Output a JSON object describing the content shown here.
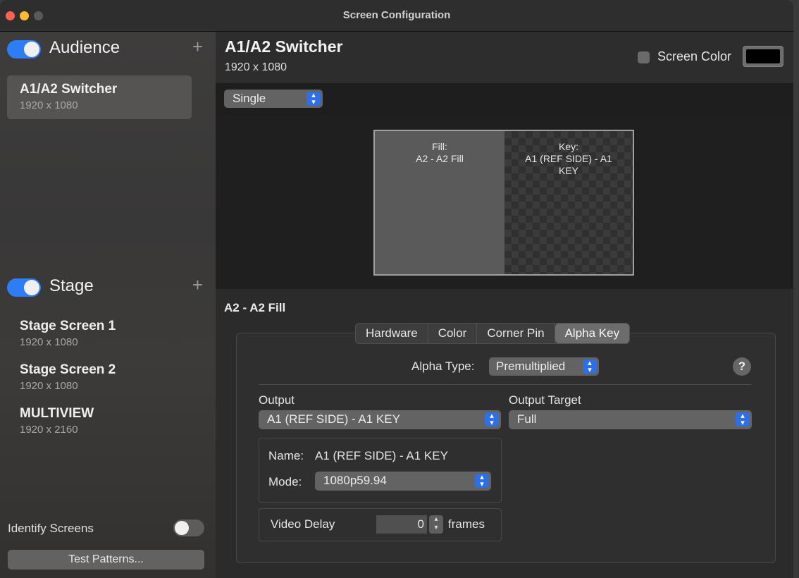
{
  "window": {
    "title": "Screen Configuration"
  },
  "sidebar": {
    "audience": {
      "title": "Audience",
      "enabled": true,
      "add_symbol": "+",
      "screens": [
        {
          "name": "A1/A2 Switcher",
          "resolution": "1920 x 1080",
          "selected": true
        }
      ]
    },
    "stage": {
      "title": "Stage",
      "enabled": true,
      "add_symbol": "+",
      "screens": [
        {
          "name": "Stage Screen 1",
          "resolution": "1920 x 1080"
        },
        {
          "name": "Stage Screen 2",
          "resolution": "1920 x 1080"
        },
        {
          "name": "MULTIVIEW",
          "resolution": "1920 x 2160"
        }
      ]
    },
    "identify_screens": {
      "label": "Identify Screens",
      "enabled": false
    },
    "test_patterns_label": "Test Patterns..."
  },
  "main": {
    "title": "A1/A2 Switcher",
    "resolution": "1920 x 1080",
    "screen_color": {
      "label": "Screen Color",
      "checked": false,
      "color": "#000000"
    },
    "layout_mode": "Single",
    "preview": {
      "fill_label": "Fill:",
      "fill_value": "A2 - A2 Fill",
      "key_label": "Key:",
      "key_value": "A1 (REF SIDE) - A1 KEY"
    },
    "selected_output_title": "A2 - A2 Fill",
    "tabs": [
      {
        "label": "Hardware",
        "active": false
      },
      {
        "label": "Color",
        "active": false
      },
      {
        "label": "Corner Pin",
        "active": false
      },
      {
        "label": "Alpha Key",
        "active": true
      }
    ],
    "alpha_key": {
      "alpha_type_label": "Alpha Type:",
      "alpha_type_value": "Premultiplied",
      "help_symbol": "?",
      "output_label": "Output",
      "output_value": "A1 (REF SIDE) - A1 KEY",
      "output_target_label": "Output Target",
      "output_target_value": "Full",
      "name_label": "Name:",
      "name_value": "A1 (REF SIDE) - A1 KEY",
      "mode_label": "Mode:",
      "mode_value": "1080p59.94",
      "video_delay_label": "Video Delay",
      "video_delay_value": "0",
      "video_delay_unit": "frames"
    }
  },
  "colors": {
    "accent": "#2e7cf6",
    "popup_chevron": "#2f6fe6",
    "close": "#fe5f57",
    "minimize": "#febc2e"
  }
}
